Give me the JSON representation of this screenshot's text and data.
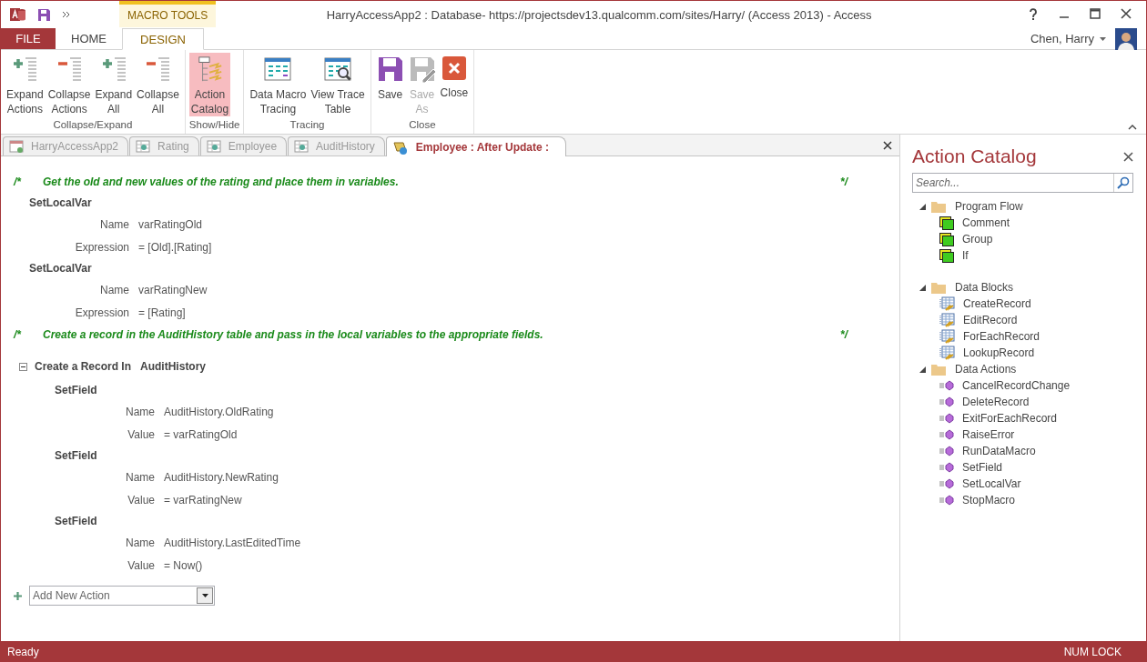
{
  "window": {
    "title": "HarryAccessApp2 : Database- https://projectsdev13.qualcomm.com/sites/Harry/ (Access 2013) - Access"
  },
  "contextual_tab": "MACRO TOOLS",
  "tabs": [
    {
      "label": "FILE",
      "kind": "file",
      "selected": false
    },
    {
      "label": "HOME",
      "kind": "plain",
      "selected": false
    },
    {
      "label": "DESIGN",
      "kind": "contextual",
      "selected": true
    }
  ],
  "user": {
    "name": "Chen, Harry"
  },
  "ribbon": [
    {
      "label": "Collapse/Expand",
      "buttons": [
        {
          "lines": [
            "Expand",
            "Actions"
          ],
          "kind": "expand",
          "selected": false,
          "disabled": false
        },
        {
          "lines": [
            "Collapse",
            "Actions"
          ],
          "kind": "collapse",
          "selected": false,
          "disabled": false
        },
        {
          "lines": [
            "Expand",
            "All"
          ],
          "kind": "expand",
          "selected": false,
          "disabled": false
        },
        {
          "lines": [
            "Collapse",
            "All"
          ],
          "kind": "collapse",
          "selected": false,
          "disabled": false
        }
      ]
    },
    {
      "label": "Show/Hide",
      "buttons": [
        {
          "lines": [
            "Action",
            "Catalog"
          ],
          "kind": "catalog",
          "selected": true,
          "disabled": false
        }
      ]
    },
    {
      "label": "Tracing",
      "buttons": [
        {
          "lines": [
            "Data Macro",
            "Tracing"
          ],
          "kind": "grid",
          "selected": false,
          "disabled": false
        },
        {
          "lines": [
            "View Trace",
            "Table"
          ],
          "kind": "grid-search",
          "selected": false,
          "disabled": false
        }
      ]
    },
    {
      "label": "Close",
      "buttons": [
        {
          "lines": [
            "Save"
          ],
          "kind": "save",
          "selected": false,
          "disabled": false
        },
        {
          "lines": [
            "Save",
            "As"
          ],
          "kind": "save-as",
          "selected": false,
          "disabled": true
        },
        {
          "lines": [
            "Close"
          ],
          "kind": "close",
          "selected": false,
          "disabled": false
        }
      ]
    }
  ],
  "doc_tabs": [
    {
      "label": "HarryAccessApp2",
      "kind": "form",
      "selected": false
    },
    {
      "label": "Rating",
      "kind": "table",
      "selected": false
    },
    {
      "label": "Employee",
      "kind": "table",
      "selected": false
    },
    {
      "label": "AuditHistory",
      "kind": "table",
      "selected": false
    },
    {
      "label": "Employee : After Update :",
      "kind": "macro",
      "selected": true
    }
  ],
  "macro": [
    {
      "kind": "comment",
      "open": "/*",
      "text": "Get the old and new values of the rating and place them in variables.",
      "close": "*/"
    },
    {
      "kind": "action",
      "name": "SetLocalVar",
      "args": [
        {
          "label": "Name",
          "value": "varRatingOld"
        },
        {
          "label": "Expression",
          "value": "= [Old].[Rating]"
        }
      ]
    },
    {
      "kind": "action",
      "name": "SetLocalVar",
      "args": [
        {
          "label": "Name",
          "value": "varRatingNew"
        },
        {
          "label": "Expression",
          "value": "= [Rating]"
        }
      ]
    },
    {
      "kind": "comment",
      "open": "/*",
      "text": "Create a record in the AuditHistory table and pass in the local variables to the appropriate fields.",
      "close": "*/"
    },
    {
      "kind": "block",
      "title": "Create a Record In",
      "target": "AuditHistory",
      "expanded": true,
      "children": [
        {
          "kind": "action",
          "name": "SetField",
          "args": [
            {
              "label": "Name",
              "value": "AuditHistory.OldRating"
            },
            {
              "label": "Value",
              "value": "= varRatingOld"
            }
          ]
        },
        {
          "kind": "action",
          "name": "SetField",
          "args": [
            {
              "label": "Name",
              "value": "AuditHistory.NewRating"
            },
            {
              "label": "Value",
              "value": "= varRatingNew"
            }
          ]
        },
        {
          "kind": "action",
          "name": "SetField",
          "args": [
            {
              "label": "Name",
              "value": "AuditHistory.LastEditedTime"
            },
            {
              "label": "Value",
              "value": "= Now()"
            }
          ]
        }
      ]
    }
  ],
  "add_action": {
    "placeholder": "Add New Action"
  },
  "catalog": {
    "title": "Action Catalog",
    "search": {
      "placeholder": "Search..."
    },
    "groups": [
      {
        "label": "Program Flow",
        "expanded": true,
        "kind": "flow",
        "items": [
          "Comment",
          "Group",
          "If"
        ]
      },
      {
        "label": "Data Blocks",
        "expanded": true,
        "kind": "block",
        "items": [
          "CreateRecord",
          "EditRecord",
          "ForEachRecord",
          "LookupRecord"
        ]
      },
      {
        "label": "Data Actions",
        "expanded": true,
        "kind": "action",
        "items": [
          "CancelRecordChange",
          "DeleteRecord",
          "ExitForEachRecord",
          "RaiseError",
          "RunDataMacro",
          "SetField",
          "SetLocalVar",
          "StopMacro"
        ]
      }
    ]
  },
  "status_bar": {
    "left": "Ready",
    "right": "NUM LOCK"
  }
}
